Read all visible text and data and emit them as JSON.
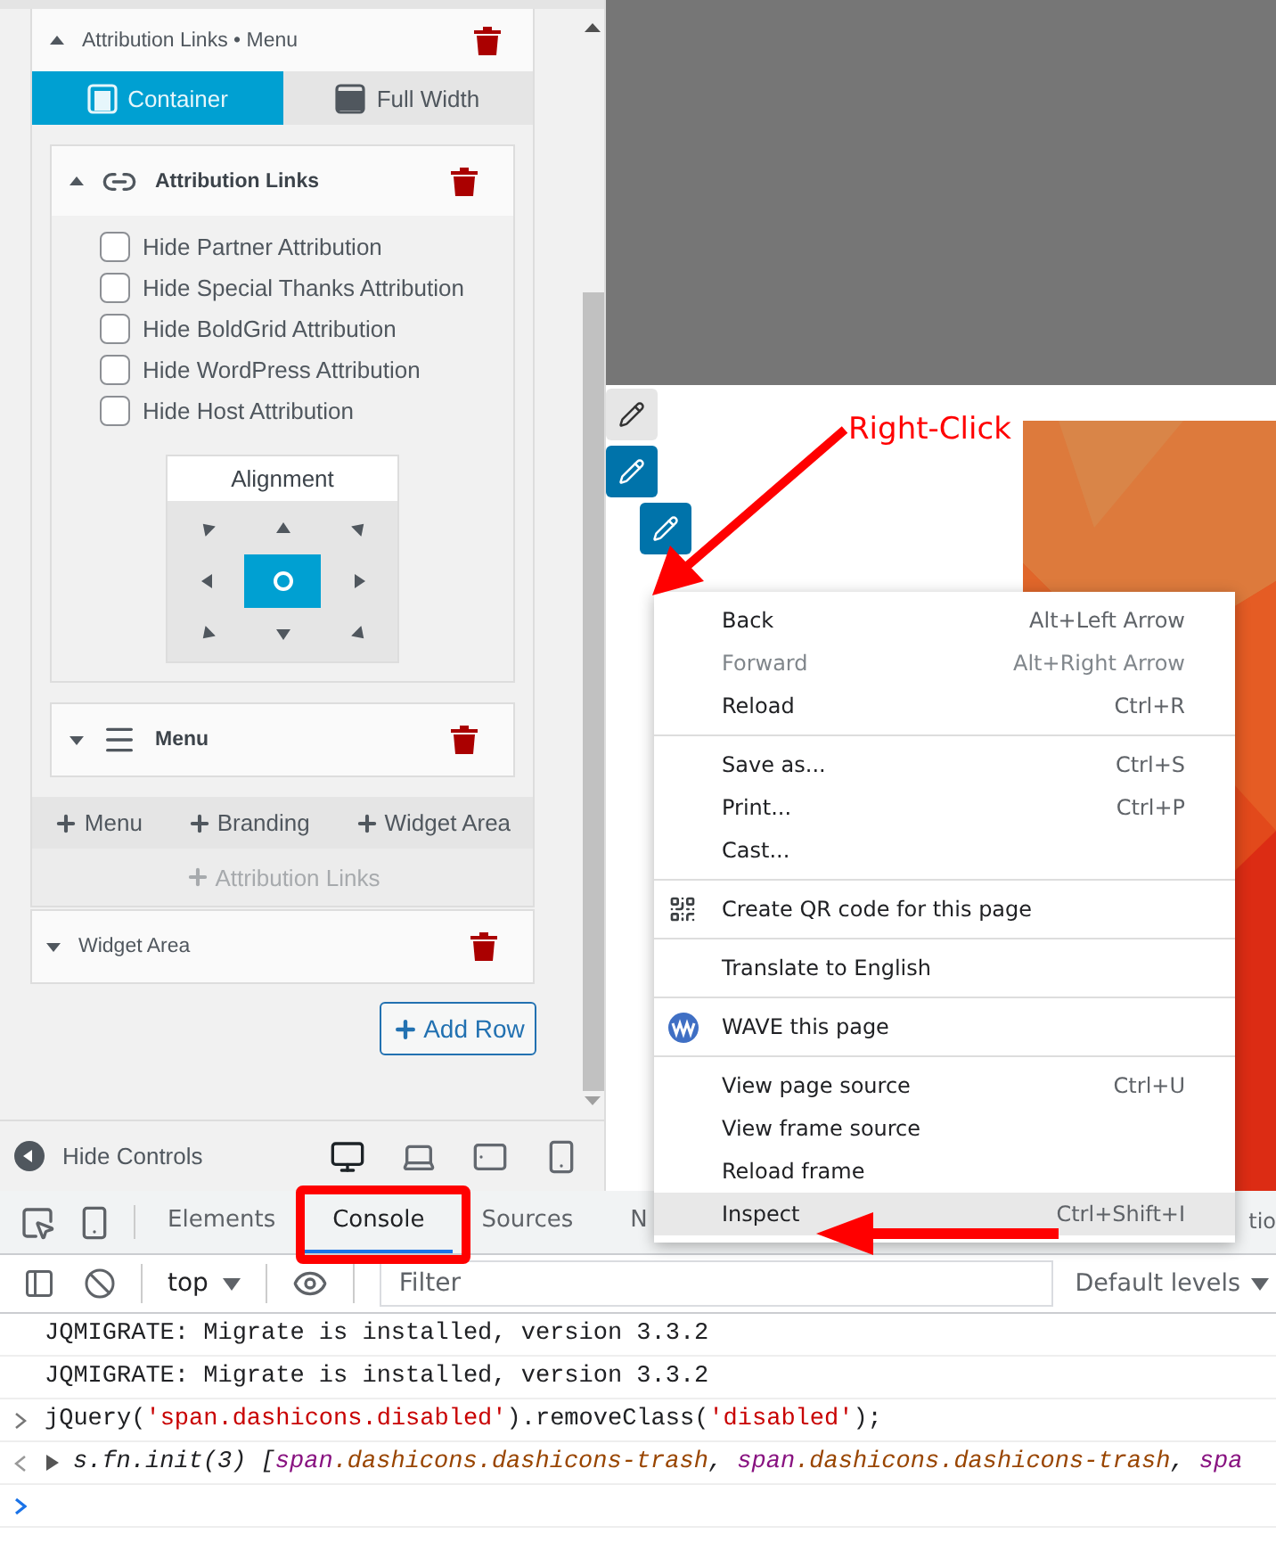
{
  "builder": {
    "row_title": "Attribution Links • Menu",
    "width_options": [
      {
        "label": "Container",
        "selected": true
      },
      {
        "label": "Full Width",
        "selected": false
      }
    ],
    "attribution_card": {
      "title": "Attribution Links",
      "expanded": true,
      "checkboxes": [
        {
          "label": "Hide Partner Attribution",
          "checked": false
        },
        {
          "label": "Hide Special Thanks Attribution",
          "checked": false
        },
        {
          "label": "Hide BoldGrid Attribution",
          "checked": false
        },
        {
          "label": "Hide WordPress Attribution",
          "checked": false
        },
        {
          "label": "Hide Host Attribution",
          "checked": false
        }
      ],
      "alignment": {
        "title": "Alignment",
        "cells": [
          {
            "selected": false
          },
          {
            "selected": false
          },
          {
            "selected": false
          },
          {
            "selected": false
          },
          {
            "selected": true
          },
          {
            "selected": false
          },
          {
            "selected": false
          },
          {
            "selected": false
          },
          {
            "selected": false
          }
        ]
      }
    },
    "menu_card": {
      "title": "Menu",
      "expanded": false
    },
    "add_buttons": [
      {
        "label": "Menu",
        "disabled": false
      },
      {
        "label": "Branding",
        "disabled": false
      },
      {
        "label": "Widget Area",
        "disabled": false
      },
      {
        "label": "Attribution Links",
        "disabled": true
      }
    ],
    "widget_row": {
      "title": "Widget Area",
      "expanded": false
    },
    "add_row": "Add Row",
    "hide_controls": "Hide Controls",
    "devices": [
      {
        "kind": "desktop",
        "selected": true
      },
      {
        "kind": "laptop",
        "selected": false
      },
      {
        "kind": "tablet",
        "selected": false
      },
      {
        "kind": "phone",
        "selected": false
      }
    ]
  },
  "preview": {
    "edit_buttons": [
      {
        "active": false
      },
      {
        "active": true
      },
      {
        "active": true
      }
    ]
  },
  "context_menu": {
    "sections": [
      [
        {
          "label": "Back",
          "shortcut": "Alt+Left Arrow",
          "disabled": false,
          "selected": false
        },
        {
          "label": "Forward",
          "shortcut": "Alt+Right Arrow",
          "disabled": true,
          "selected": false
        },
        {
          "label": "Reload",
          "shortcut": "Ctrl+R",
          "disabled": false,
          "selected": false
        }
      ],
      [
        {
          "label": "Save as...",
          "shortcut": "Ctrl+S",
          "disabled": false,
          "selected": false
        },
        {
          "label": "Print...",
          "shortcut": "Ctrl+P",
          "disabled": false,
          "selected": false
        },
        {
          "label": "Cast...",
          "disabled": false,
          "selected": false
        }
      ],
      [
        {
          "label": "Create QR code for this page",
          "kind": "qr",
          "disabled": false,
          "selected": false
        }
      ],
      [
        {
          "label": "Translate to English",
          "disabled": false,
          "selected": false
        }
      ],
      [
        {
          "label": "WAVE this page",
          "kind": "extension",
          "disabled": false,
          "selected": false
        }
      ],
      [
        {
          "label": "View page source",
          "shortcut": "Ctrl+U",
          "disabled": false,
          "selected": false
        },
        {
          "label": "View frame source",
          "disabled": false,
          "selected": false
        },
        {
          "label": "Reload frame",
          "disabled": false,
          "selected": false
        },
        {
          "label": "Inspect",
          "shortcut": "Ctrl+Shift+I",
          "disabled": false,
          "selected": true
        }
      ]
    ]
  },
  "annotations": {
    "right_click_label": "Right-Click"
  },
  "devtools": {
    "tabs": [
      {
        "label": "Elements",
        "selected": false
      },
      {
        "label": "Console",
        "selected": true
      },
      {
        "label": "Sources",
        "selected": false
      },
      {
        "label": "N",
        "selected": false
      },
      {
        "label": "tio",
        "selected": false
      }
    ],
    "context": "top",
    "filter": {
      "placeholder": "Filter"
    },
    "levels": "Default levels",
    "messages": [
      {
        "kind": "log",
        "segments": [
          {
            "kind": "plain",
            "text": "JQMIGRATE: Migrate is installed, version 3.3.2"
          }
        ]
      },
      {
        "kind": "log",
        "segments": [
          {
            "kind": "plain",
            "text": "JQMIGRATE: Migrate is installed, version 3.3.2"
          }
        ]
      },
      {
        "kind": "input",
        "segments": [
          {
            "kind": "plain",
            "text": "jQuery("
          },
          {
            "kind": "string",
            "text": "'span.dashicons.disabled'"
          },
          {
            "kind": "plain",
            "text": ").removeClass("
          },
          {
            "kind": "string",
            "text": "'disabled'"
          },
          {
            "kind": "plain",
            "text": ");"
          }
        ]
      },
      {
        "kind": "output",
        "segments": [
          {
            "kind": "plain",
            "text": "s.fn.init(3) ["
          },
          {
            "kind": "tag",
            "text": "span"
          },
          {
            "kind": "attr",
            "text": ".dashicons.dashicons-trash"
          },
          {
            "kind": "plain",
            "text": ", "
          },
          {
            "kind": "tag",
            "text": "span"
          },
          {
            "kind": "attr",
            "text": ".dashicons.dashicons-trash"
          },
          {
            "kind": "plain",
            "text": ", "
          },
          {
            "kind": "tag",
            "text": "spa"
          }
        ]
      },
      {
        "kind": "prompt"
      }
    ]
  }
}
